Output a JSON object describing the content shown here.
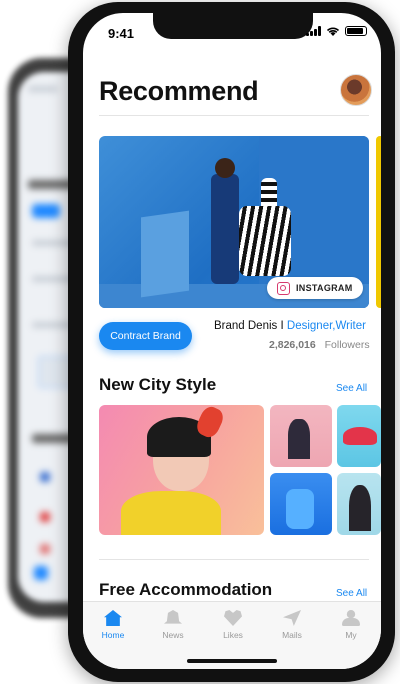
{
  "status_bar": {
    "time": "9:41"
  },
  "header": {
    "title": "Recommend"
  },
  "hero": {
    "badge": "INSTAGRAM",
    "contract_button": "Contract Brand",
    "brand_name": "Brand Denis",
    "separator": "I",
    "roles": "Designer,Writer",
    "follower_count": "2,826,016",
    "followers_label": "Followers"
  },
  "city_style": {
    "title": "New City Style",
    "see_all": "See All"
  },
  "accommodation": {
    "title": "Free Accommodation",
    "see_all": "See All"
  },
  "tabs": [
    {
      "label": "Home",
      "icon": "home-icon"
    },
    {
      "label": "News",
      "icon": "bell-icon"
    },
    {
      "label": "Likes",
      "icon": "heart-icon"
    },
    {
      "label": "Mails",
      "icon": "paper-plane-icon"
    },
    {
      "label": "My",
      "icon": "user-icon"
    }
  ],
  "colors": {
    "accent": "#1a88f0",
    "tab_inactive": "#c7c7c7"
  }
}
